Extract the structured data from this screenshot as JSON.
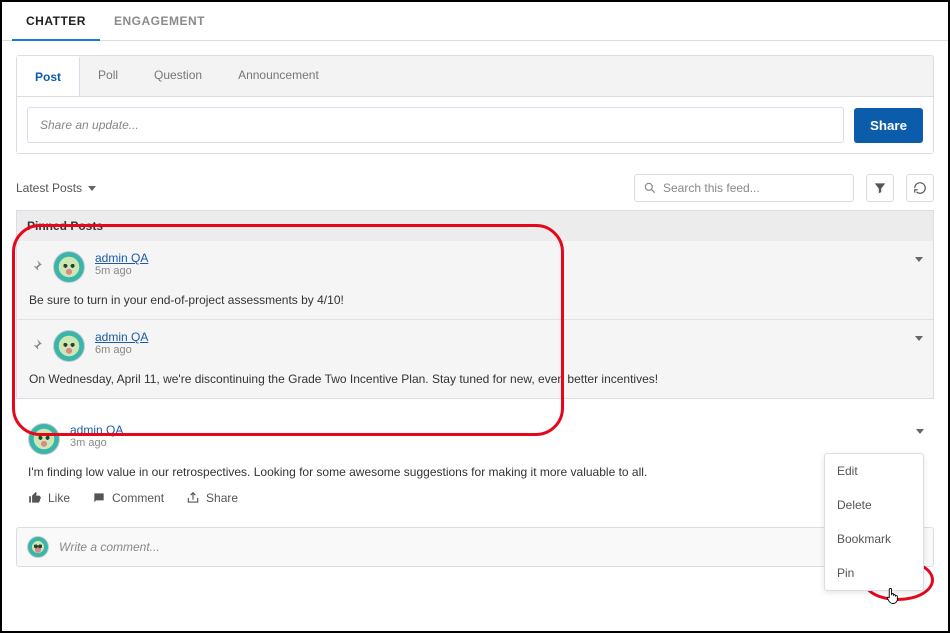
{
  "top_tabs": {
    "chatter": "CHATTER",
    "engagement": "ENGAGEMENT"
  },
  "composer": {
    "tabs": {
      "post": "Post",
      "poll": "Poll",
      "question": "Question",
      "announcement": "Announcement"
    },
    "placeholder": "Share an update...",
    "share_label": "Share"
  },
  "toolbar": {
    "sort_label": "Latest Posts",
    "search_placeholder": "Search this feed..."
  },
  "pinned_header": "Pinned Posts",
  "pinned": [
    {
      "author": "admin QA",
      "time": "5m ago",
      "body": "Be sure to turn in your end-of-project assessments by 4/10!"
    },
    {
      "author": "admin QA",
      "time": "6m ago",
      "body": "On Wednesday, April 11, we're discontinuing the Grade Two Incentive Plan. Stay tuned for new, even better incentives!"
    }
  ],
  "posts": [
    {
      "author": "admin QA",
      "time": "3m ago",
      "body": "I'm finding low value in our retrospectives. Looking for some awesome suggestions for making it more valuable to all."
    }
  ],
  "actions": {
    "like": "Like",
    "comment": "Comment",
    "share": "Share"
  },
  "comment_placeholder": "Write a comment...",
  "dropdown": {
    "edit": "Edit",
    "delete": "Delete",
    "bookmark": "Bookmark",
    "pin": "Pin"
  }
}
